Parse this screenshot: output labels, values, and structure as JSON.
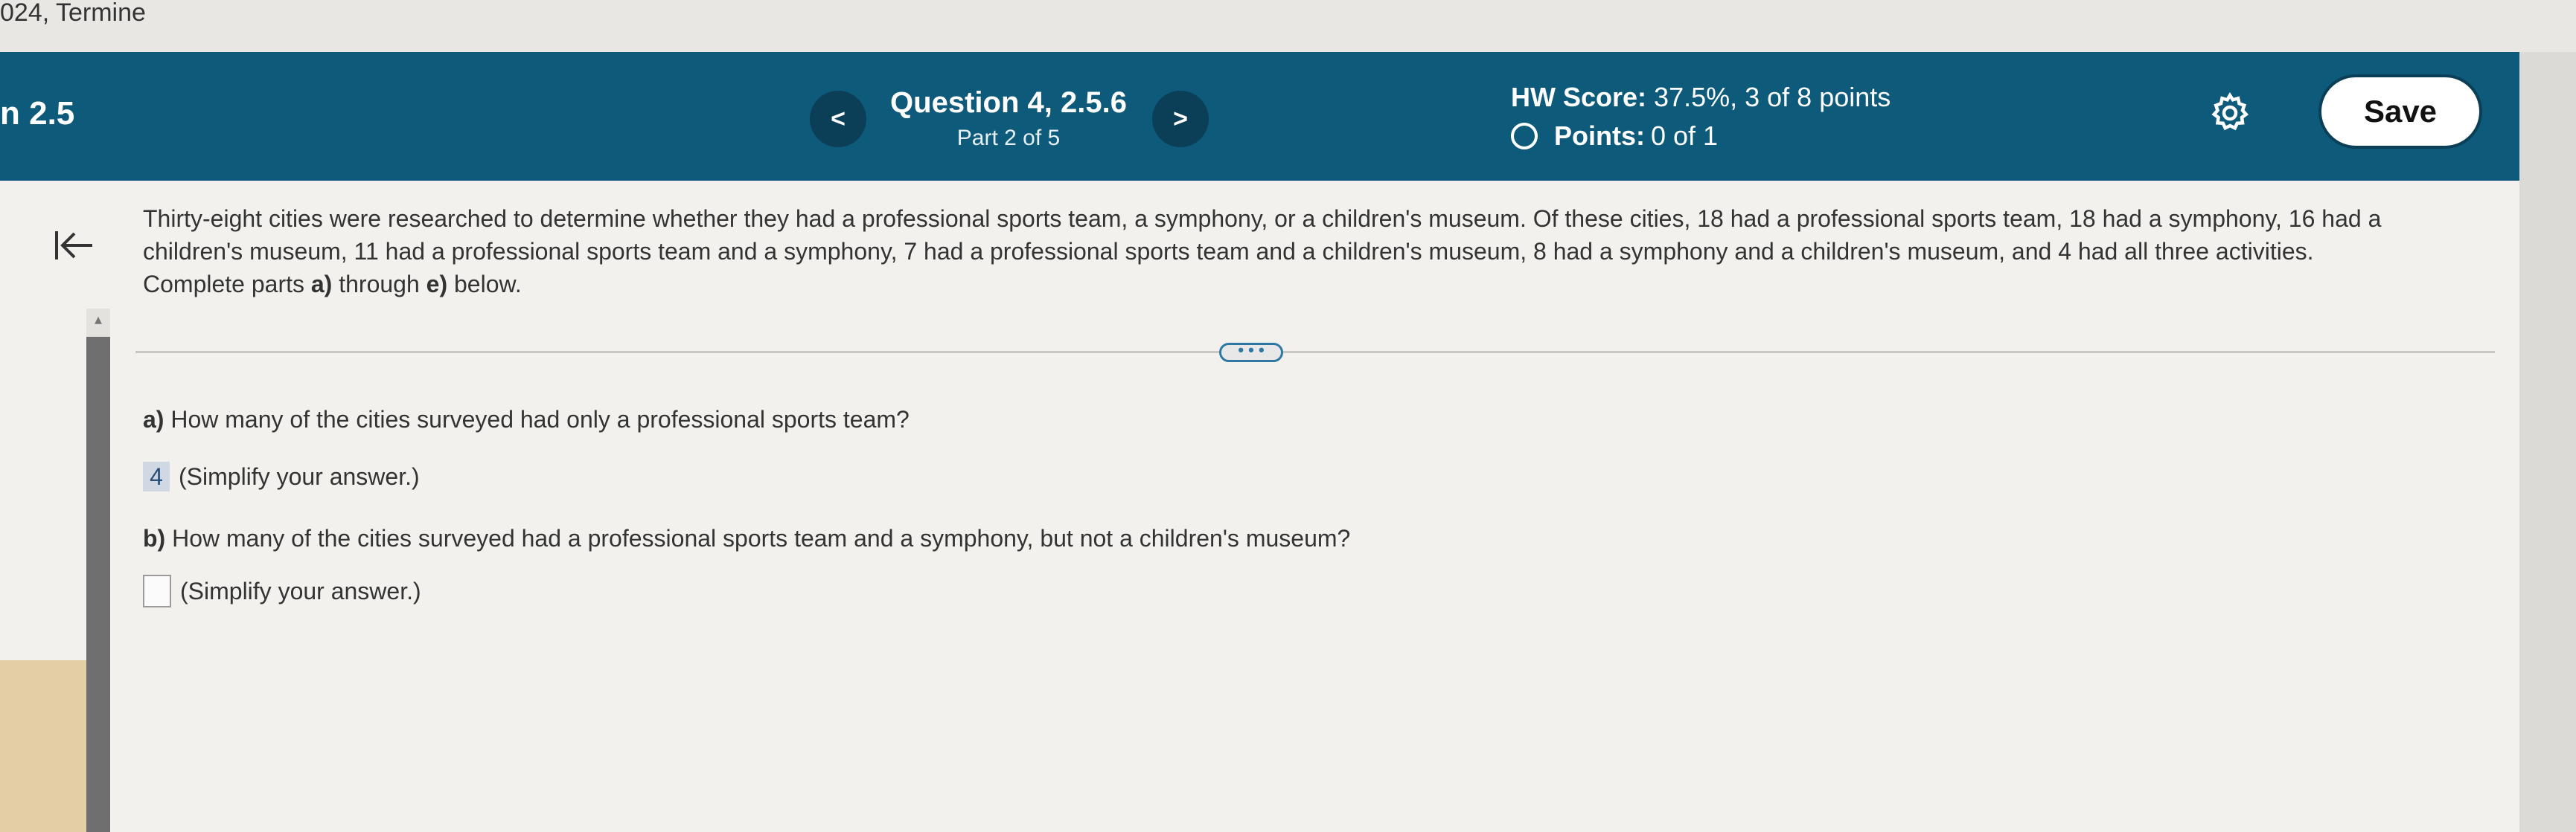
{
  "browser": {
    "course_title": "024, Termine"
  },
  "header": {
    "section": "n 2.5",
    "prev_label": "<",
    "next_label": ">",
    "question_title": "Question 4, 2.5.6",
    "question_part": "Part 2 of 5",
    "hw_score_label": "HW Score:",
    "hw_score_value": "37.5%, 3 of 8 points",
    "points_label": "Points:",
    "points_value": "0 of 1",
    "save_label": "Save",
    "settings_icon": "gear-icon"
  },
  "problem": {
    "text_intro": "Thirty-eight cities were researched to determine whether they had a professional sports team, a symphony, or a children's museum. Of these cities, 18 had a professional sports team, 18 had a symphony, 16 had a children's museum, 11 had a professional sports team and a symphony, 7 had a professional sports team and a children's museum, 8 had a symphony and a children's museum, and 4 had all three activities.",
    "complete_prefix": "Complete parts ",
    "part_start": "a)",
    "through": " through ",
    "part_end": "e)",
    "below": " below."
  },
  "more_button_label": "• • •",
  "questions": {
    "a": {
      "letter": "a)",
      "text": " How many of the cities surveyed had only a professional sports team?",
      "answer_value": "4",
      "hint": "(Simplify your answer.)"
    },
    "b": {
      "letter": "b)",
      "text": " How many of the cities surveyed had a professional sports team and a symphony, but not a children's museum?",
      "answer_value": "",
      "hint": "(Simplify your answer.)"
    }
  },
  "colors": {
    "header_bg": "#0e5a7a",
    "nav_btn_bg": "#0a3f57",
    "answer_highlight": "#cfd8e3",
    "more_btn_border": "#2e78a3"
  }
}
